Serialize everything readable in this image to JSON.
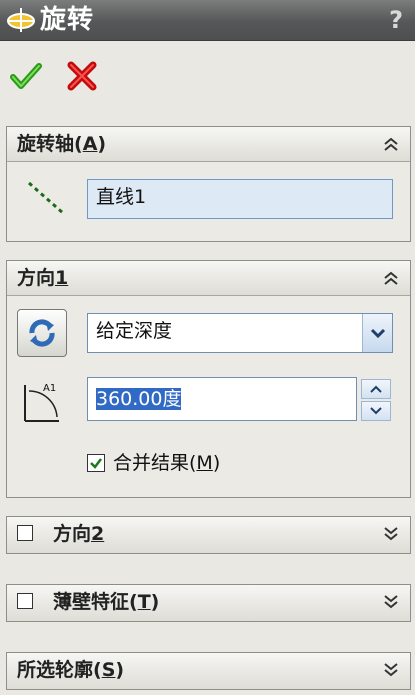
{
  "title": {
    "text": "旋转",
    "help": "?"
  },
  "actions": {
    "ok_icon": "green-check-icon",
    "cancel_icon": "red-x-icon"
  },
  "axis_panel": {
    "label": "旋转轴",
    "shortcut_open": "(",
    "shortcut_key": "A",
    "shortcut_close": ")",
    "field_value": "直线1"
  },
  "direction1_panel": {
    "label": "方向",
    "shortcut_key": "1",
    "end_condition": "给定深度",
    "angle_value": "360.00度",
    "merge_label_pre": "合并结果(",
    "merge_label_key": "M",
    "merge_label_post": ")",
    "merge_checked": true
  },
  "direction2_panel": {
    "label": "方向",
    "shortcut_key": "2",
    "checked": false
  },
  "thin_panel": {
    "label": "薄壁特征(",
    "shortcut_key": "T",
    "label_post": ")",
    "checked": false
  },
  "contours_panel": {
    "label": "所选轮廓(",
    "shortcut_key": "S",
    "label_post": ")"
  },
  "colors": {
    "accent": "#316ac5",
    "titlebar": "#5a5c5d",
    "ok": "#2a9a1a",
    "cancel": "#d01010"
  }
}
